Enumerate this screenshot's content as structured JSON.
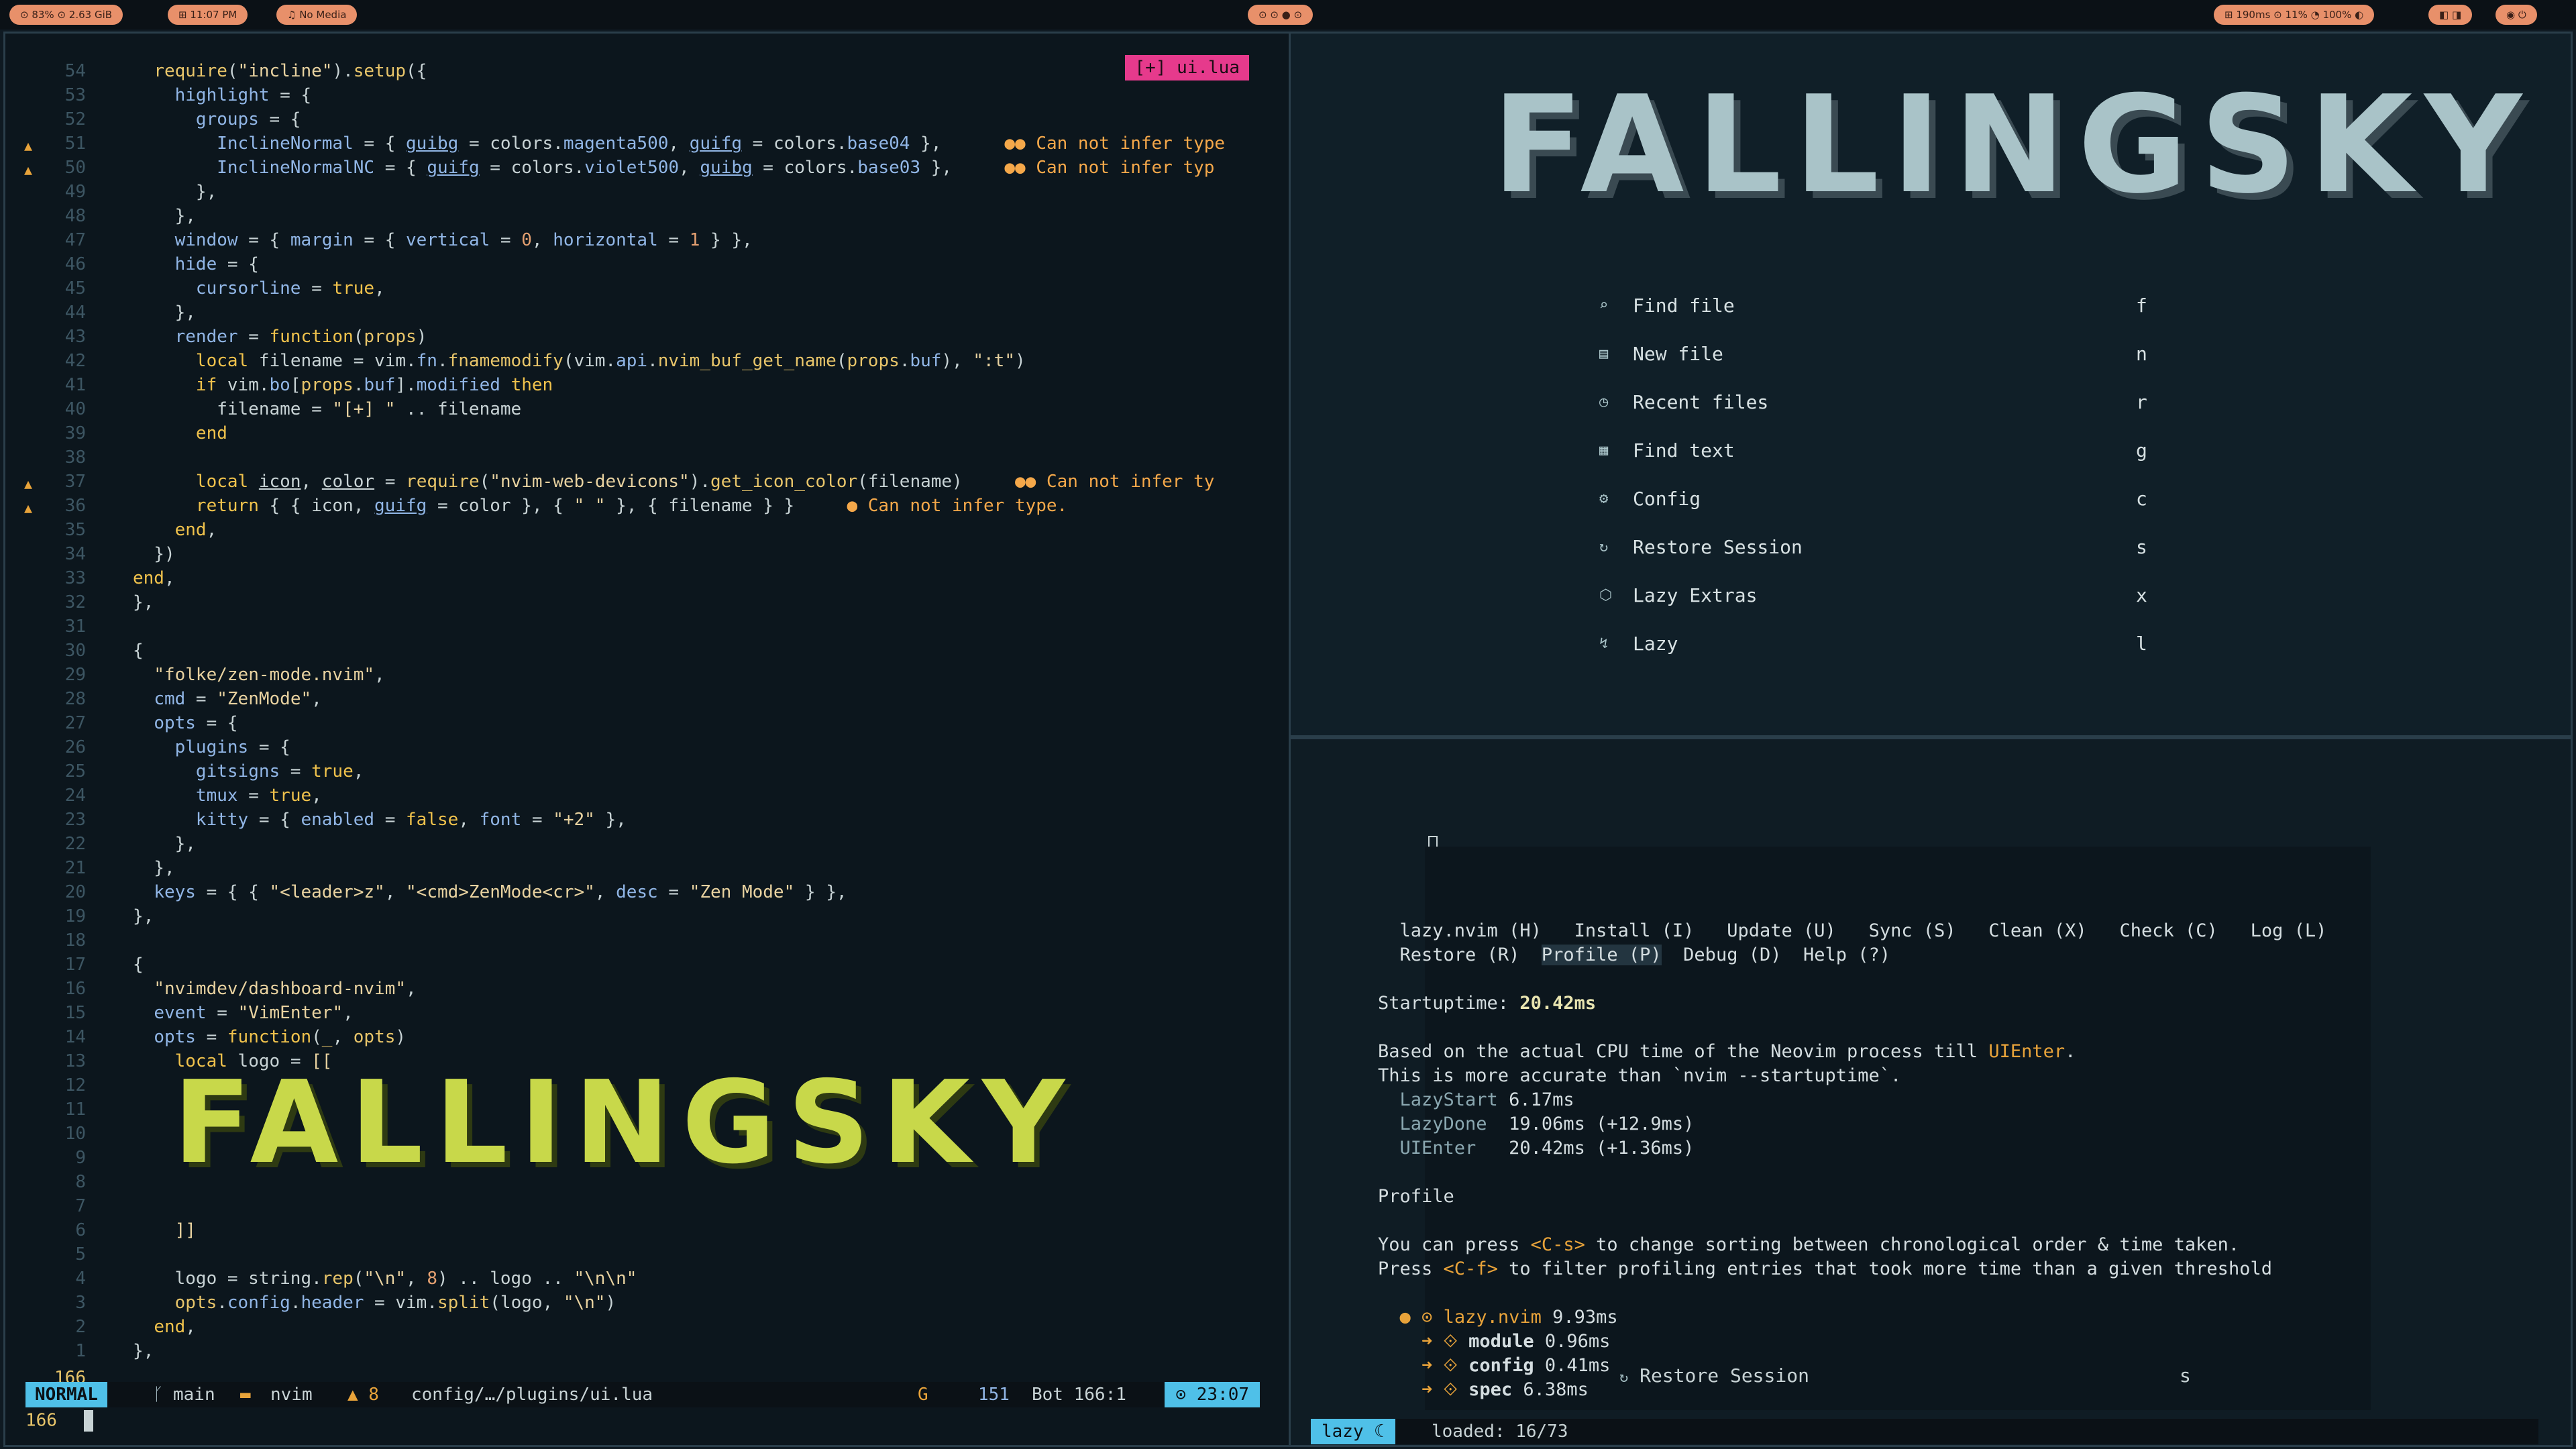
{
  "topbar": {
    "left": [
      "⊙ 83% ⊙ 2.63 GiB",
      "⊞ 11:07 PM",
      "♫ No Media"
    ],
    "center": "⊙ ⊙ ● ⊙",
    "right": [
      "⊞ 190ms ⊙ 11% ◔ 100% ◐",
      "◧ ◨",
      "◉ ⏻"
    ]
  },
  "editor": {
    "file_badge": "[+] ui.lua",
    "line_numbers": [
      "54",
      "53",
      "52",
      "51",
      "50",
      "49",
      "48",
      "47",
      "46",
      "45",
      "44",
      "43",
      "42",
      "41",
      "40",
      "39",
      "38",
      "37",
      "36",
      "35",
      "34",
      "33",
      "32",
      "31",
      "30",
      "29",
      "28",
      "27",
      "26",
      "25",
      "24",
      "23",
      "22",
      "21",
      "20",
      "19",
      "18",
      "17",
      "16",
      "15",
      "14",
      "13",
      "12",
      "11",
      "10",
      "9",
      "8",
      "7",
      "6",
      "5",
      "4",
      "3",
      "2",
      "1",
      "166"
    ],
    "warning_icon": "▲",
    "diag_text": "Can not infer type",
    "diag_text_short": "Can not infer typ",
    "diag_text_shorter": "Can not infer ty",
    "diag_text_period": "Can not infer type.",
    "logo_text": "FALLINGSKY",
    "status": {
      "mode": "NORMAL",
      "branch": "main",
      "project": "nvim",
      "warnings": "▲ 8",
      "path": "config/…/plugins/ui.lua",
      "g": "G",
      "lines": "151",
      "pos": "Bot 166:1",
      "time": "⊙ 23:07"
    },
    "cmdline": "166"
  },
  "dashboard": {
    "logo_text": "FALLINGSKY",
    "menu": [
      {
        "icon": "⌕",
        "label": "Find file",
        "key": "f"
      },
      {
        "icon": "▤",
        "label": "New file",
        "key": "n"
      },
      {
        "icon": "◷",
        "label": "Recent files",
        "key": "r"
      },
      {
        "icon": "▦",
        "label": "Find text",
        "key": "g"
      },
      {
        "icon": "⚙",
        "label": "Config",
        "key": "c"
      },
      {
        "icon": "↻",
        "label": "Restore Session",
        "key": "s"
      },
      {
        "icon": "⬡",
        "label": "Lazy Extras",
        "key": "x"
      },
      {
        "icon": "↯",
        "label": "Lazy",
        "key": "l"
      }
    ]
  },
  "lazy": {
    "tabs_row1": [
      "lazy.nvim (H)",
      "Install (I)",
      "Update (U)",
      "Sync (S)",
      "Clean (X)",
      "Check (C)",
      "Log (L)"
    ],
    "tabs_row2": [
      "Restore (R)",
      "Profile (P)",
      "Debug (D)",
      "Help (?)"
    ],
    "startup_label": "Startuptime:",
    "startup_value": "20.42ms",
    "desc1_a": "Based on the actual CPU time of the Neovim process till ",
    "desc1_b": "UIEnter",
    "desc1_c": ".",
    "desc2": "This is more accurate than `nvim --startuptime`.",
    "stats": [
      {
        "name": "LazyStart",
        "value": "6.17ms"
      },
      {
        "name": "LazyDone",
        "value": "19.06ms (+12.9ms)"
      },
      {
        "name": "UIEnter",
        "value": "20.42ms (+1.36ms)"
      }
    ],
    "profile_heading": "Profile",
    "p1_a": "You can press ",
    "p1_b": "<C-s>",
    "p1_c": " to change sorting between chronological order & time taken.",
    "p2_a": "Press ",
    "p2_b": "<C-f>",
    "p2_c": " to filter profiling entries that took more time than a given threshold",
    "tree": [
      {
        "name": "lazy.nvim",
        "value": "9.93ms"
      },
      {
        "name": "module",
        "value": "0.96ms"
      },
      {
        "name": "config",
        "value": "0.41ms"
      },
      {
        "name": "spec",
        "value": "6.38ms"
      }
    ],
    "restore_label": "Restore Session",
    "restore_key": "s",
    "bar_name": "lazy ☾",
    "bar_loaded": "loaded: 16/73"
  },
  "colors": {
    "accent": "#4fc0e8",
    "warning": "#e8a33a",
    "badge": "#e63a8c",
    "editor_logo": "#c8d84a",
    "dash_logo": "#a9c3c8"
  }
}
